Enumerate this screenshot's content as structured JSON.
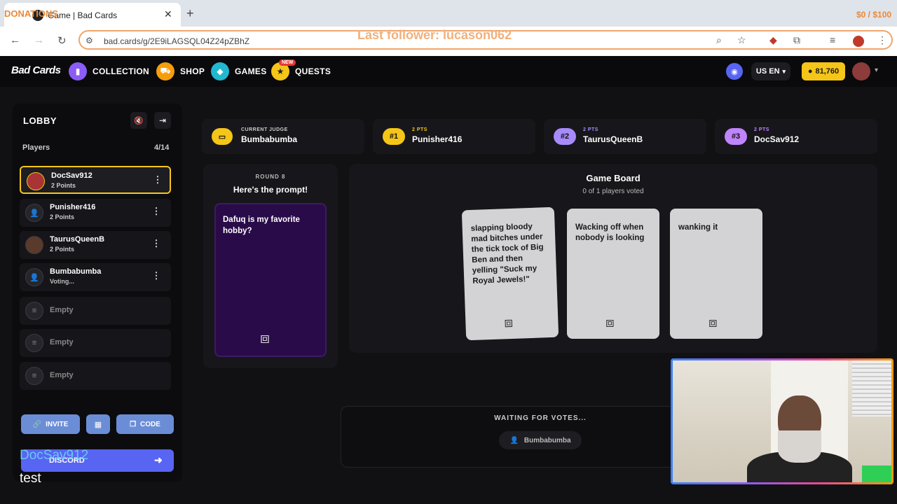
{
  "browser": {
    "tab_title": "Game | Bad Cards",
    "url": "bad.cards/g/2E9iLAGSQL04Z24pZBhZ",
    "overlay_donations": "DONATIONS",
    "overlay_donation_amount": "$0 / $100",
    "overlay_follower": "Last follower: lucason062"
  },
  "header": {
    "logo": "Bad Cards",
    "nav": [
      {
        "label": "COLLECTION",
        "icon": "collection-icon",
        "color": "#8b5cf6"
      },
      {
        "label": "SHOP",
        "icon": "cart-icon",
        "color": "#f59e0b"
      },
      {
        "label": "GAMES",
        "icon": "games-icon",
        "color": "#22b8cf"
      },
      {
        "label": "QUESTS",
        "icon": "quests-icon",
        "color": "#f5c518"
      }
    ],
    "new_badge": "NEW",
    "lang": "US EN",
    "coins": "81,760"
  },
  "lobby": {
    "title": "LOBBY",
    "players_label": "Players",
    "players_count": "4/14",
    "players": [
      {
        "name": "DocSav912",
        "sub": "2 Points",
        "active": true
      },
      {
        "name": "Punisher416",
        "sub": "2 Points"
      },
      {
        "name": "TaurusQueenB",
        "sub": "2 Points"
      },
      {
        "name": "Bumbabumba",
        "sub": "Voting..."
      }
    ],
    "empty_label": "Empty",
    "invite": "INVITE",
    "code": "CODE",
    "discord": "DISCORD",
    "overlay_name": "DocSav912",
    "overlay_test": "test"
  },
  "scores": {
    "judge_label": "CURRENT JUDGE",
    "judge_name": "Bumbabumba",
    "ranks": [
      {
        "rank": "#1",
        "pts": "2 PTS",
        "name": "Punisher416",
        "color": "#f5c518"
      },
      {
        "rank": "#2",
        "pts": "2 PTS",
        "name": "TaurusQueenB",
        "color": "#a78bfa"
      },
      {
        "rank": "#3",
        "pts": "2 PTS",
        "name": "DocSav912",
        "color": "#a855f7"
      }
    ]
  },
  "prompt": {
    "round": "ROUND 8",
    "heading": "Here's the prompt!",
    "text": "Dafuq is my favorite hobby?"
  },
  "board": {
    "title": "Game Board",
    "subtitle": "0 of 1 players voted",
    "cards": [
      "slapping bloody mad bitches under the tick tock of Big Ben and then yelling \"Suck my Royal Jewels!\"",
      "Wacking off when nobody is looking",
      "wanking it"
    ]
  },
  "waiting": {
    "title": "WAITING FOR VOTES...",
    "player": "Bumbabumba"
  }
}
